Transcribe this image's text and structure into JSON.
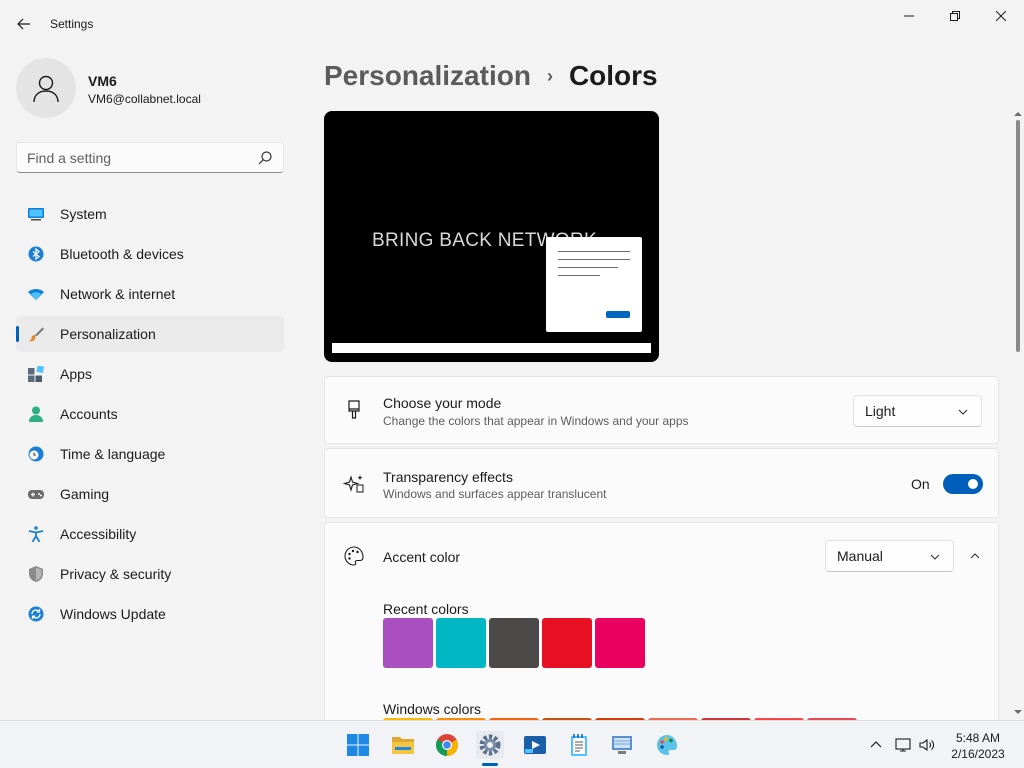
{
  "window": {
    "title": "Settings",
    "back_icon": "back-arrow-icon",
    "controls": [
      "minimize-icon",
      "maximize-icon",
      "close-icon"
    ]
  },
  "profile": {
    "name": "VM6",
    "email": "VM6@collabnet.local"
  },
  "search": {
    "placeholder": "Find a setting"
  },
  "sidebar": {
    "items": [
      {
        "label": "System",
        "icon": "system-icon",
        "active": false
      },
      {
        "label": "Bluetooth & devices",
        "icon": "bluetooth-icon",
        "active": false
      },
      {
        "label": "Network & internet",
        "icon": "wifi-icon",
        "active": false
      },
      {
        "label": "Personalization",
        "icon": "brush-icon",
        "active": true
      },
      {
        "label": "Apps",
        "icon": "apps-icon",
        "active": false
      },
      {
        "label": "Accounts",
        "icon": "accounts-icon",
        "active": false
      },
      {
        "label": "Time & language",
        "icon": "clock-globe-icon",
        "active": false
      },
      {
        "label": "Gaming",
        "icon": "gamepad-icon",
        "active": false
      },
      {
        "label": "Accessibility",
        "icon": "accessibility-icon",
        "active": false
      },
      {
        "label": "Privacy & security",
        "icon": "shield-icon",
        "active": false
      },
      {
        "label": "Windows Update",
        "icon": "update-icon",
        "active": false
      }
    ]
  },
  "breadcrumb": {
    "parent": "Personalization",
    "separator": "›",
    "current": "Colors"
  },
  "preview": {
    "wallpaper_text": "BRING BACK NETWORK"
  },
  "mode": {
    "title": "Choose your mode",
    "subtitle": "Change the colors that appear in Windows and your apps",
    "value": "Light",
    "icon": "paintbrush-icon"
  },
  "transparency": {
    "title": "Transparency effects",
    "subtitle": "Windows and surfaces appear translucent",
    "state_label": "On",
    "enabled": true,
    "icon": "sparkle-icon"
  },
  "accent": {
    "title": "Accent color",
    "value": "Manual",
    "icon": "palette-icon",
    "recent_label": "Recent colors",
    "recent_colors": [
      "#a94fbf",
      "#00b7c3",
      "#4c4a48",
      "#e81123",
      "#ea005e"
    ],
    "windows_label": "Windows colors",
    "windows_colors": [
      "#ffb900",
      "#ff8c00",
      "#f7630c",
      "#ca5010",
      "#da3b01",
      "#ef6950",
      "#d13438",
      "#ff4343",
      "#e74856"
    ]
  },
  "taskbar": {
    "apps": [
      "start-icon",
      "file-explorer-icon",
      "chrome-icon",
      "settings-icon",
      "media-player-icon",
      "notepad-icon",
      "remote-desktop-icon",
      "paint-icon"
    ],
    "active_app": "settings-icon",
    "tray_icons": [
      "chevron-up-icon",
      "network-icon",
      "volume-icon"
    ],
    "time": "5:48 AM",
    "date": "2/16/2023"
  },
  "colors": {
    "accent": "#005fb8",
    "background": "#f3f3f3",
    "card": "#fbfbfb"
  }
}
